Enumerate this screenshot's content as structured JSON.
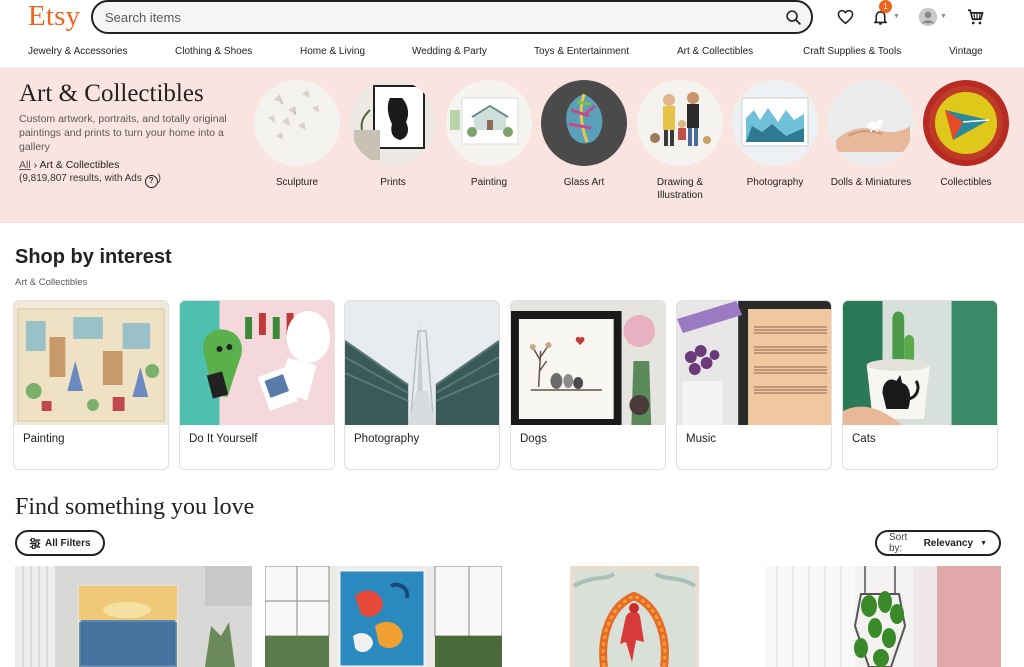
{
  "header": {
    "logo": "Etsy",
    "search_placeholder": "Search items",
    "notification_count": "1"
  },
  "catnav": [
    "Jewelry & Accessories",
    "Clothing & Shoes",
    "Home & Living",
    "Wedding & Party",
    "Toys & Entertainment",
    "Art & Collectibles",
    "Craft Supplies & Tools",
    "Vintage"
  ],
  "hero": {
    "title": "Art & Collectibles",
    "description": "Custom artwork, portraits, and totally original paintings and prints to turn your home into a gallery",
    "breadcrumb_all": "All",
    "breadcrumb_sep": "›",
    "breadcrumb_current": "Art & Collectibles",
    "results": "(9,819,807 results, with Ads",
    "results_close": ")",
    "help_icon_glyph": "?",
    "subcategories": [
      {
        "label": "Sculpture"
      },
      {
        "label": "Prints"
      },
      {
        "label": "Painting"
      },
      {
        "label": "Glass Art"
      },
      {
        "label": "Drawing & Illustration"
      },
      {
        "label": "Photography"
      },
      {
        "label": "Dolls & Miniatures"
      },
      {
        "label": "Collectibles"
      }
    ]
  },
  "shop_by_interest": {
    "title": "Shop by interest",
    "subtitle": "Art & Collectibles",
    "cards": [
      {
        "label": "Painting"
      },
      {
        "label": "Do It Yourself"
      },
      {
        "label": "Photography"
      },
      {
        "label": "Dogs"
      },
      {
        "label": "Music"
      },
      {
        "label": "Cats"
      }
    ]
  },
  "find_something": {
    "title": "Find something you love",
    "filters_label": "All Filters",
    "sort_prefix": "Sort by:",
    "sort_value": "Relevancy"
  },
  "colors": {
    "brand": "#f1641e",
    "hero_bg": "#fae4e0"
  }
}
